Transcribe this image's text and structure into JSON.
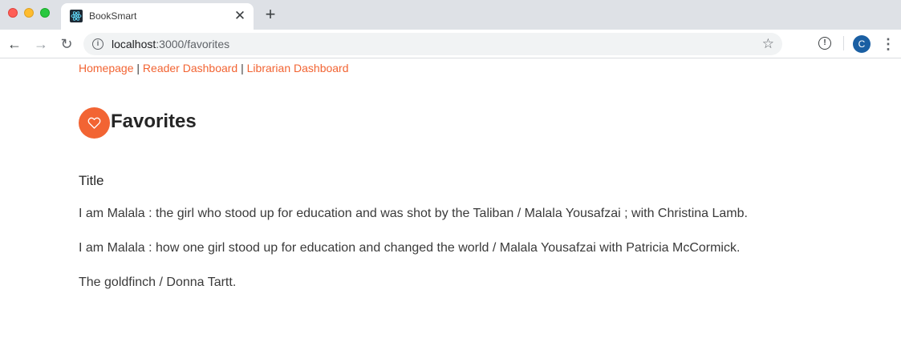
{
  "browser": {
    "tab_title": "BookSmart",
    "tab_close": "✕",
    "new_tab": "+",
    "url_host": "localhost",
    "url_path": ":3000/favorites",
    "avatar_letter": "C",
    "icons": {
      "back": "←",
      "forward": "→",
      "reload": "↻",
      "info": "i",
      "star": "☆",
      "extension": "!",
      "menu": "⋮"
    }
  },
  "nav": {
    "links": [
      "Homepage",
      "Reader Dashboard",
      "Librarian Dashboard"
    ],
    "separator": "|"
  },
  "page": {
    "title": "Favorites",
    "accent_color": "#f26433",
    "column_header": "Title",
    "books": [
      "I am Malala : the girl who stood up for education and was shot by the Taliban / Malala Yousafzai ; with Christina Lamb.",
      "I am Malala : how one girl stood up for education and changed the world / Malala Yousafzai with Patricia McCormick.",
      "The goldfinch / Donna Tartt."
    ]
  }
}
